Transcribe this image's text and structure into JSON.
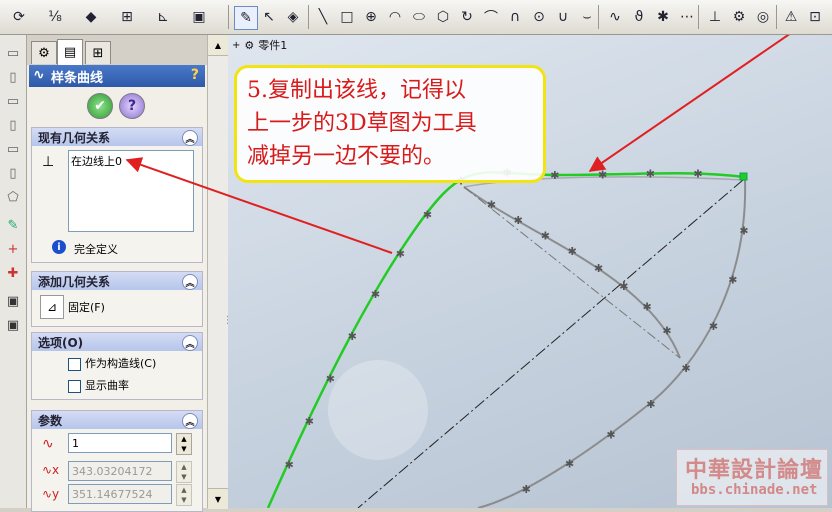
{
  "toolbar": {
    "icons": [
      "rebuild-icon",
      "smart-dimension-icon",
      "sketch-relation-icon",
      "convert-entities-icon",
      "mirror-icon",
      "trim-icon",
      "sketch-icon",
      "smart-dim-icon",
      "line-icon",
      "rectangle-icon",
      "circle-icon",
      "arc-icon",
      "ellipse-icon",
      "polygon-icon",
      "spline-icon",
      "point-icon",
      "fillet-icon",
      "chamfer-icon",
      "offset-icon",
      "relations-icon",
      "display-delete-icon",
      "view-orientation-icon"
    ]
  },
  "feature_tree": {
    "part_name": "零件1"
  },
  "property_manager": {
    "title": "样条曲线",
    "existing_relations": {
      "header": "现有几何关系",
      "items": [
        "在边线上0"
      ],
      "status": "完全定义"
    },
    "add_relations": {
      "header": "添加几何关系",
      "fixed_label": "固定(F)"
    },
    "options": {
      "header": "选项(O)",
      "construction_label": "作为构造线(C)",
      "curvature_label": "显示曲率"
    },
    "parameters": {
      "header": "参数",
      "point_count": "1",
      "x_value": "343.03204172",
      "y_value": "351.14677524"
    }
  },
  "callout": {
    "lines": [
      "5.复制出该线，记得以",
      "上一步的3D草图为工具",
      "减掉另一边不要的。"
    ]
  },
  "watermark": {
    "name": "中華設計論壇",
    "url": "bbs.chinade.net"
  },
  "colors": {
    "spline": "#22cc22",
    "arrow": "#e02020",
    "callout_border": "#f2e313",
    "callout_text": "#d81a1a",
    "title_bar": "#2d59a8"
  }
}
